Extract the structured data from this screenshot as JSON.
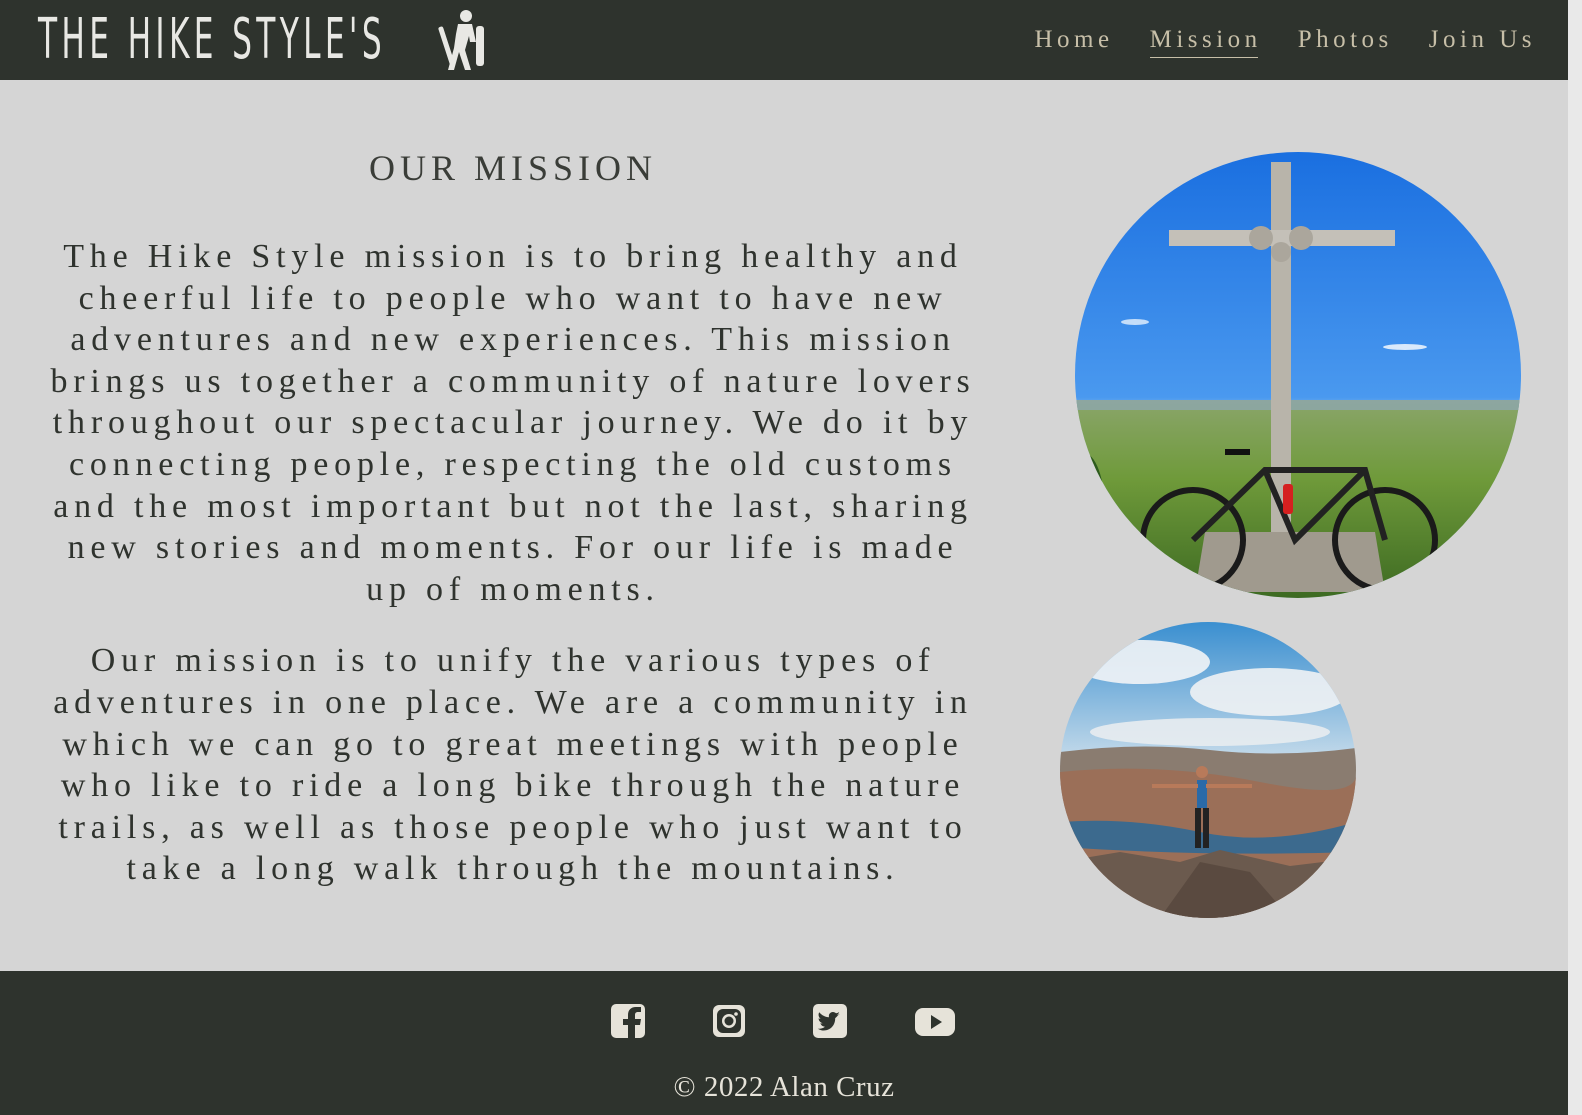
{
  "header": {
    "brand": "THE HIKE STYLE'S",
    "nav": [
      {
        "label": "Home",
        "active": false
      },
      {
        "label": "Mission",
        "active": true
      },
      {
        "label": "Photos",
        "active": false
      },
      {
        "label": "Join Us",
        "active": false
      }
    ]
  },
  "main": {
    "title": "OUR MISSION",
    "paragraphs": [
      "The Hike Style mission is to bring healthy and cheerful life to people who want to have new adventures and new experiences. This mission brings us together a community of nature lovers throughout our spectacular journey. We do it by connecting people, respecting the old customs and the most important but not the last, sharing new stories and moments. For our life is made up of moments.",
      "Our mission is to unify the various types of adventures in one place. We are a community in which we can go to great meetings with people who like to ride a long bike through the nature trails, as well as those people who just want to take a long walk through the mountains."
    ]
  },
  "footer": {
    "social": [
      "facebook-icon",
      "instagram-icon",
      "twitter-icon",
      "youtube-icon"
    ],
    "copyright": "© 2022 Alan Cruz"
  },
  "colors": {
    "header_bg": "#2e332d",
    "page_bg": "#d5d5d5",
    "nav_text": "#c7bfa8",
    "body_text": "#2f332e"
  }
}
